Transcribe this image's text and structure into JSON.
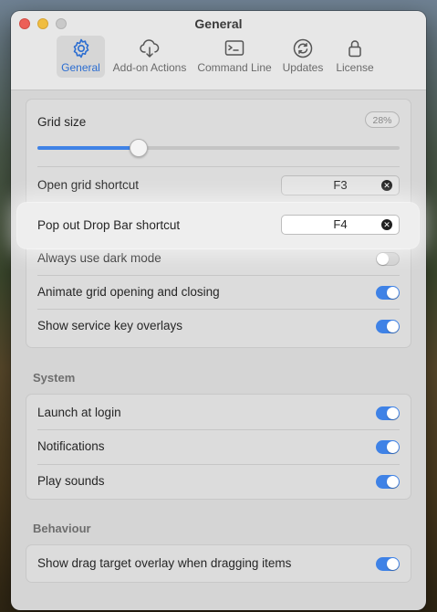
{
  "window": {
    "title": "General"
  },
  "tabs": [
    {
      "label": "General",
      "icon": "gear-icon",
      "active": true
    },
    {
      "label": "Add-on Actions",
      "icon": "cloud-icon",
      "active": false
    },
    {
      "label": "Command Line",
      "icon": "terminal-icon",
      "active": false
    },
    {
      "label": "Updates",
      "icon": "refresh-icon",
      "active": false
    },
    {
      "label": "License",
      "icon": "lock-icon",
      "active": false
    }
  ],
  "general": {
    "grid_size": {
      "label": "Grid size",
      "value": "28%",
      "fraction": 0.28
    },
    "open_grid_shortcut": {
      "label": "Open grid shortcut",
      "key": "F3"
    },
    "popout_shortcut": {
      "label": "Pop out Drop Bar shortcut",
      "key": "F4"
    },
    "dark_mode": {
      "label": "Always use dark mode",
      "on": false
    },
    "animate_grid": {
      "label": "Animate grid opening and closing",
      "on": true
    },
    "service_keys": {
      "label": "Show service key overlays",
      "on": true
    }
  },
  "system": {
    "title": "System",
    "launch_login": {
      "label": "Launch at login",
      "on": true
    },
    "notifications": {
      "label": "Notifications",
      "on": true
    },
    "play_sounds": {
      "label": "Play sounds",
      "on": true
    }
  },
  "behaviour": {
    "title": "Behaviour",
    "drag_overlay": {
      "label": "Show drag target overlay when dragging items",
      "on": true
    }
  },
  "colors": {
    "accent": "#3f82e6",
    "close": "#ec5f57",
    "minimize": "#f0bd40"
  }
}
